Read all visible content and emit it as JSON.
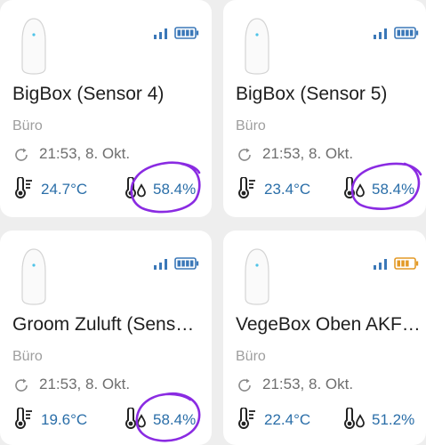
{
  "colors": {
    "accent_blue": "#2a6ea8",
    "signal_blue": "#3b78b8",
    "battery_blue": "#3b78b8",
    "battery_orange": "#e39a27",
    "annotation_purple": "#8a2be2",
    "card_bg": "#ffffff",
    "page_bg": "#eeeeee"
  },
  "icons": {
    "device": "sensor-device-icon",
    "signal": "signal-strength-icon",
    "battery": "battery-icon",
    "refresh": "refresh-icon",
    "temperature": "thermometer-icon",
    "humidity": "humidity-icon"
  },
  "sensors": [
    {
      "name": "BigBox (Sensor 4)",
      "room": "Büro",
      "updated": "21:53, 8. Okt.",
      "temperature": "24.7°C",
      "humidity": "58.4%",
      "battery_level": 1.0,
      "battery_color": "blue",
      "humidity_circled": true
    },
    {
      "name": "BigBox (Sensor 5)",
      "room": "Büro",
      "updated": "21:53, 8. Okt.",
      "temperature": "23.4°C",
      "humidity": "58.4%",
      "battery_level": 1.0,
      "battery_color": "blue",
      "humidity_circled": true
    },
    {
      "name": "Groom Zuluft (Sens…",
      "room": "Büro",
      "updated": "21:53, 8. Okt.",
      "temperature": "19.6°C",
      "humidity": "58.4%",
      "battery_level": 1.0,
      "battery_color": "blue",
      "humidity_circled": true
    },
    {
      "name": "VegeBox Oben AKF…",
      "room": "Büro",
      "updated": "21:53, 8. Okt.",
      "temperature": "22.4°C",
      "humidity": "51.2%",
      "battery_level": 0.75,
      "battery_color": "orange",
      "humidity_circled": false
    }
  ]
}
